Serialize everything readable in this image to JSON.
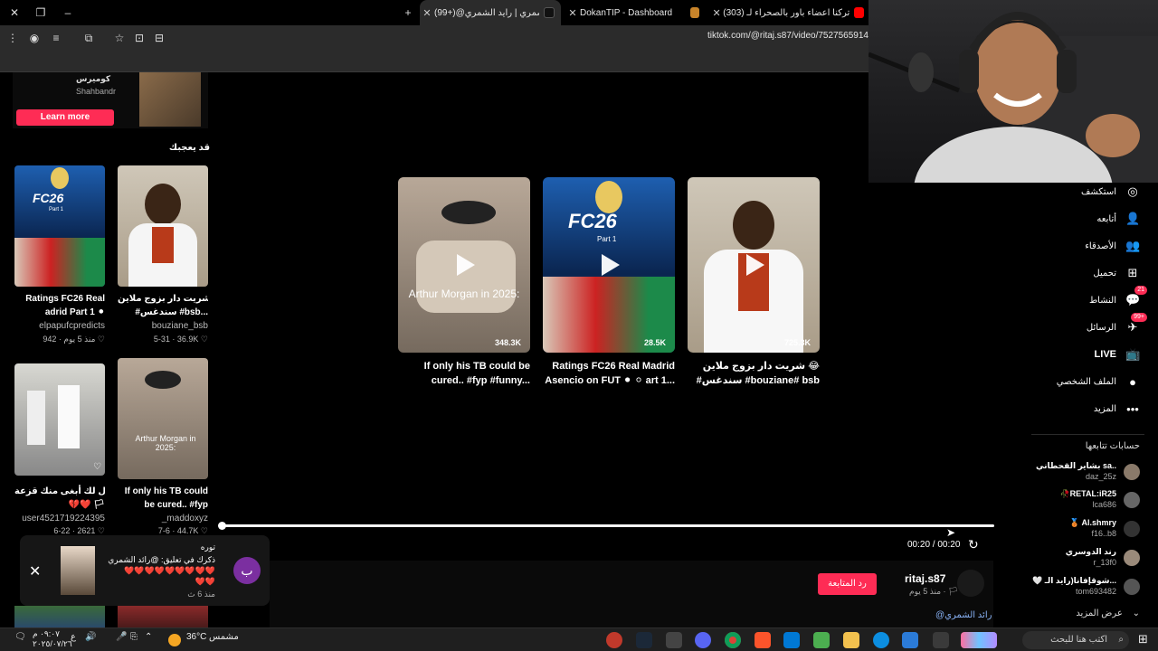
{
  "tabs": [
    {
      "label": "(303) تركنا اعضاء باور بالصحراء لـ",
      "favicon_color": "#ff0000"
    },
    {
      "label": "",
      "favicon_color": "#c8842a"
    },
    {
      "label": "DokanTIP - Dashboard",
      "favicon_color": "#4a4a4a"
    },
    {
      "label": "(99+)@رائد الشمري | رايد الشمري",
      "favicon_color": "#111111"
    }
  ],
  "toolbar": {
    "url": "tiktok.com/@ritaj.s87/video/7527565914"
  },
  "ad": {
    "title": "كوميرس",
    "sponsor": "Shahbandr",
    "cta": "Learn more"
  },
  "recommend": {
    "title": "قد يعجبك",
    "items": [
      {
        "title1": "Ratings FC26 Real",
        "title2": "adrid Part 1 ⚫",
        "user": "elpapufcpredicts",
        "meta": "منذ 5 يوم · 942 ♡"
      },
      {
        "title1": "شريت دار بزوج ملاين 😂",
        "title2": "#سندغس #bsb...",
        "user": "bouziane_bsb",
        "meta": "5-31 · 36.9K ♡"
      },
      {
        "title1": "يقول لك أبغى منك قزعة#",
        "title2": "💔❤️ 🏳",
        "user": "user4521719224395",
        "meta": "6-22 · 2621 ♡"
      },
      {
        "title1": "If only his TB could",
        "title2": "be cured.. #fyp",
        "user": "_maddoxyz",
        "meta": "7-6 · 44.7K ♡"
      }
    ]
  },
  "grid": [
    {
      "views": "725.3K",
      "caption1": "شريت دار بزوج ملاين 😂",
      "caption2": "#سندغس #bouziane# bsb"
    },
    {
      "views": "28.5K",
      "caption1": "Ratings FC26 Real Madrid",
      "caption2": "Asencio on FUT ⚫ ⚪ art 1..."
    },
    {
      "views": "348.3K",
      "caption1": "If only his TB could be",
      "caption2": "cured.. #fyp #funny..."
    }
  ],
  "thumb_texts": {
    "fc26": "FC26",
    "part": "Part 1",
    "arthur": "Arthur Morgan in 2025:"
  },
  "player": {
    "time": "00:20 / 00:20",
    "progress": 1.0
  },
  "author": {
    "name": "ritaj.s87",
    "meta": "منذ 5 يوم · 🏳",
    "next_button": "رد المتابعة",
    "mention": "@رائد الشمري"
  },
  "notification": {
    "line1": "توره",
    "line2": "ذكرك في تعليق: @رائد الشمري",
    "line3": "❤️❤️❤️❤️❤️❤️❤️❤️❤️",
    "line4": "❤️❤️",
    "time": "منذ 6 ث",
    "avatar_letter": "ب"
  },
  "sidebar": {
    "items": [
      {
        "label": "استكشف",
        "icon": "◎",
        "badge": ""
      },
      {
        "label": "أتابعه",
        "icon": "👤",
        "badge": ""
      },
      {
        "label": "الأصدقاء",
        "icon": "👥",
        "badge": ""
      },
      {
        "label": "تحميل",
        "icon": "⊞",
        "badge": ""
      },
      {
        "label": "النشاط",
        "icon": "💬",
        "badge": "21"
      },
      {
        "label": "الرسائل",
        "icon": "✈",
        "badge": "99+"
      },
      {
        "label": "LIVE",
        "icon": "📺",
        "badge": ""
      },
      {
        "label": "الملف الشخصي",
        "icon": "●",
        "badge": ""
      },
      {
        "label": "المزيد",
        "icon": "•••",
        "badge": ""
      }
    ],
    "following_title": "حسابات تتابعها",
    "following": [
      {
        "name": "بشاير القحطاني sa..",
        "handle": "daz_25z"
      },
      {
        "name": "🥀RETAL:iR25",
        "handle": "lca686"
      },
      {
        "name": "🥉 Al.shmry",
        "handle": "f16..b8"
      },
      {
        "name": "رند الدوسري",
        "handle": "r_13f0"
      },
      {
        "name": "🤍 شوقإفانا(رايد الـ...",
        "handle": "tom693482"
      }
    ],
    "see_more": "عرض المزيد"
  },
  "taskbar": {
    "time": "٠٩:٠٧ م",
    "date": "٢٠٢٥/٠٧/٢٦",
    "weather": "36°C",
    "weather_label": "مشمس",
    "search": "اكتب هنا للبحث",
    "lang": "ع"
  }
}
